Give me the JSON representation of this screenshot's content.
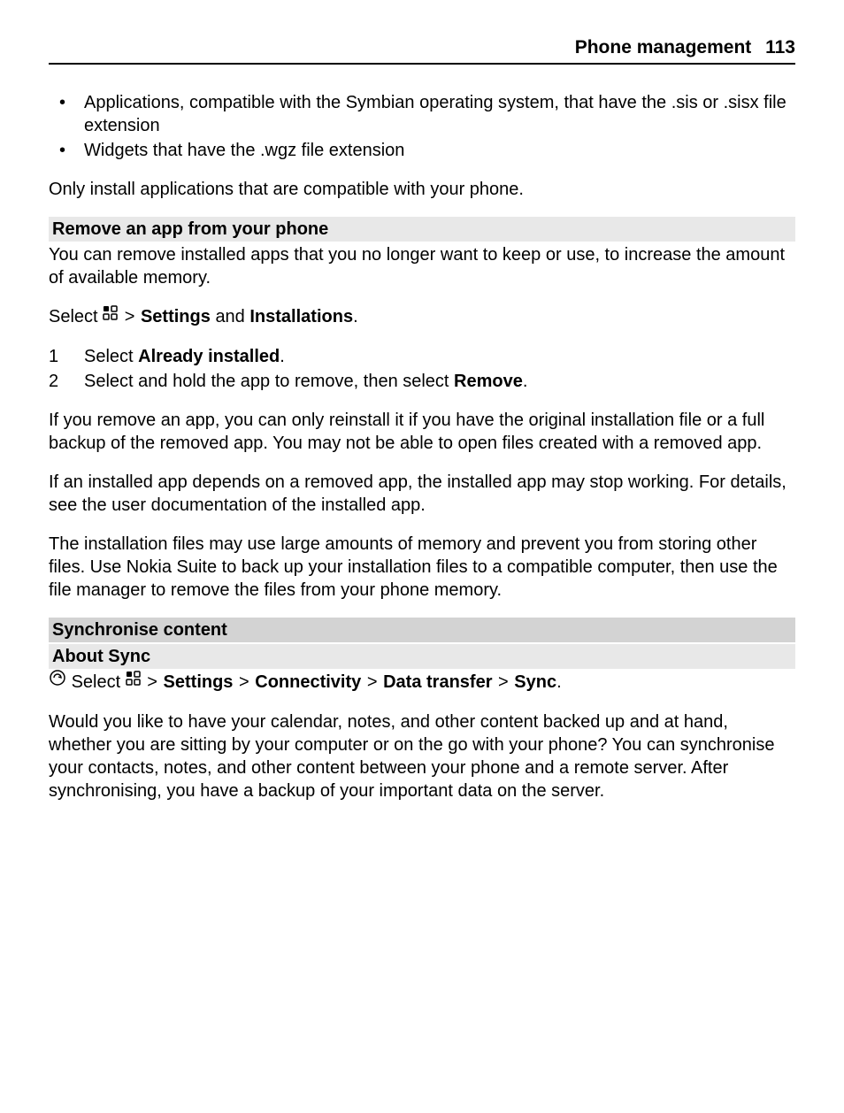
{
  "header": {
    "title": "Phone management",
    "page": "113"
  },
  "bullets": [
    "Applications, compatible with the Symbian operating system, that have the .sis or .sisx file extension",
    "Widgets that have the .wgz file extension"
  ],
  "intro_para": "Only install applications that are compatible with your phone.",
  "section1": {
    "heading": "Remove an app from your phone",
    "para1": "You can remove installed apps that you no longer want to keep or use, to increase the amount of available memory.",
    "select_prefix": "Select",
    "breadcrumb_sep": ">",
    "settings_label": "Settings",
    "and_text": "and",
    "installations_label": "Installations",
    "period": ".",
    "steps": [
      {
        "num": "1",
        "prefix": "Select ",
        "bold": "Already installed",
        "suffix": "."
      },
      {
        "num": "2",
        "prefix": "Select and hold the app to remove, then select ",
        "bold": "Remove",
        "suffix": "."
      }
    ],
    "para2": "If you remove an app, you can only reinstall it if you have the original installation file or a full backup of the removed app. You may not be able to open files created with a removed app.",
    "para3": "If an installed app depends on a removed app, the installed app may stop working. For details, see the user documentation of the installed app.",
    "para4": "The installation files may use large amounts of memory and prevent you from storing other files. Use Nokia Suite to back up your installation files to a compatible computer, then use the file manager to remove the files from your phone memory."
  },
  "section2": {
    "heading": "Synchronise content",
    "subheading": "About Sync",
    "select_prefix": "Select",
    "breadcrumb_sep": ">",
    "settings_label": "Settings",
    "connectivity_label": "Connectivity",
    "data_transfer_label": "Data transfer",
    "sync_label": "Sync",
    "period": ".",
    "para1": "Would you like to have your calendar, notes, and other content backed up and at hand, whether you are sitting by your computer or on the go with your phone? You can synchronise your contacts, notes, and other content between your phone and a remote server. After synchronising, you have a backup of your important data on the server."
  }
}
